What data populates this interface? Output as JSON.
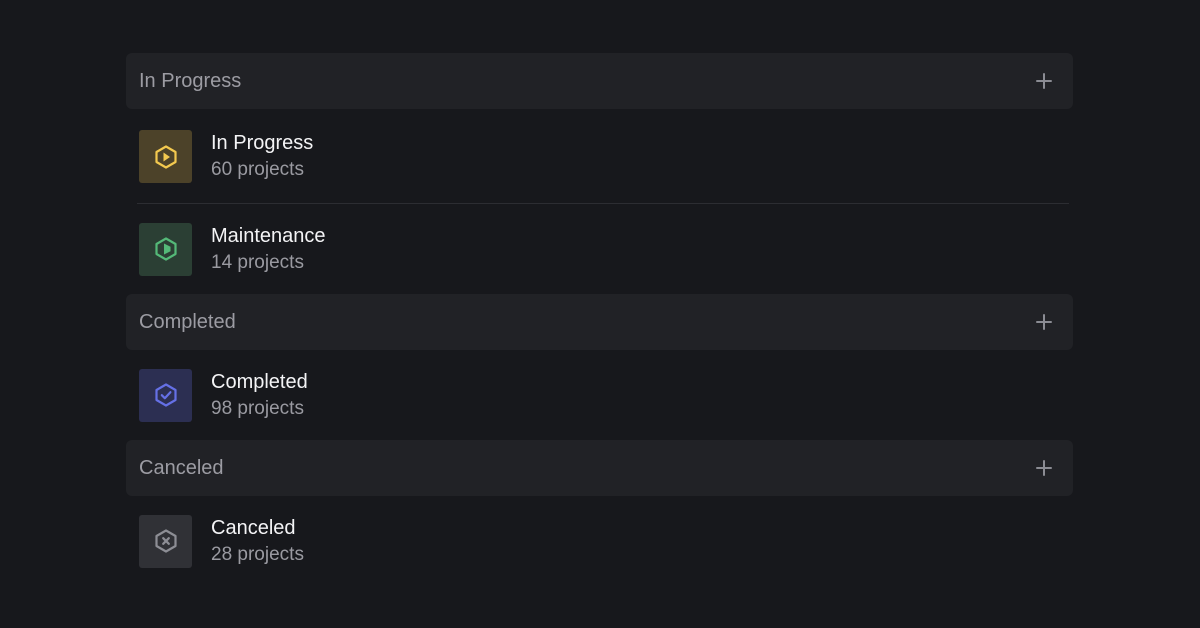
{
  "groups": [
    {
      "title": "In Progress",
      "items": [
        {
          "name": "In Progress",
          "count": "60 projects",
          "icon": "hexagon-play-icon",
          "icon_color": "#f3c94f",
          "icon_bg": "#4c4229"
        },
        {
          "name": "Maintenance",
          "count": "14 projects",
          "icon": "hexagon-half-icon",
          "icon_color": "#54b978",
          "icon_bg": "#2b3f34"
        }
      ]
    },
    {
      "title": "Completed",
      "items": [
        {
          "name": "Completed",
          "count": "98 projects",
          "icon": "hexagon-check-icon",
          "icon_color": "#6570e6",
          "icon_bg": "#2c2f52"
        }
      ]
    },
    {
      "title": "Canceled",
      "items": [
        {
          "name": "Canceled",
          "count": "28 projects",
          "icon": "hexagon-x-icon",
          "icon_color": "#8d8e95",
          "icon_bg": "#303136"
        }
      ]
    }
  ],
  "colors": {
    "background": "#17181c",
    "group_header_bg": "#212226",
    "divider": "#2c2d32",
    "plus_icon": "#8b8c93"
  }
}
